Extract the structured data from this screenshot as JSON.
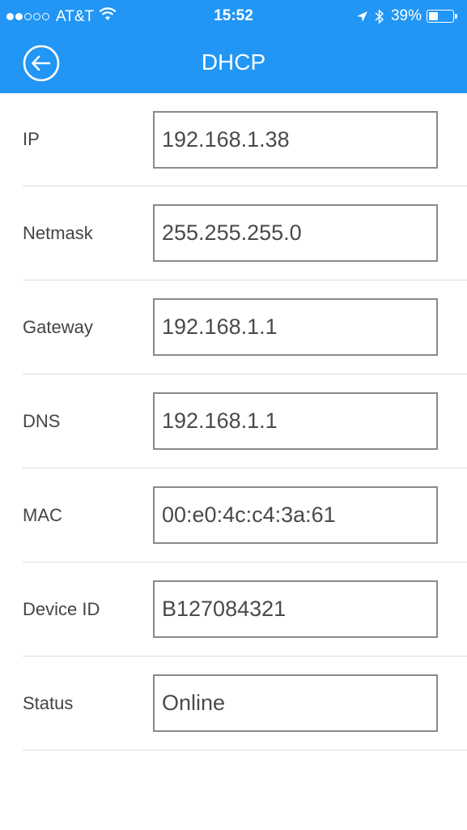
{
  "status_bar": {
    "carrier": "AT&T",
    "signal_bars_filled": 2,
    "signal_bars_total": 5,
    "time": "15:52",
    "battery_percent": "39%",
    "battery_level": 0.39,
    "icons": [
      "signal-icon",
      "wifi-icon",
      "location-arrow-icon",
      "bluetooth-icon",
      "battery-icon"
    ]
  },
  "nav": {
    "title": "DHCP",
    "back_icon": "back-arrow-circle-icon"
  },
  "colors": {
    "header_bg": "#2196f5",
    "header_text": "#ffffff",
    "label_text": "#444444",
    "field_border": "#8a8a8a",
    "divider": "#dcdcdc"
  },
  "fields": [
    {
      "label": "IP",
      "value": "192.168.1.38"
    },
    {
      "label": "Netmask",
      "value": "255.255.255.0"
    },
    {
      "label": "Gateway",
      "value": "192.168.1.1"
    },
    {
      "label": "DNS",
      "value": "192.168.1.1"
    },
    {
      "label": "MAC",
      "value": "00:e0:4c:c4:3a:61"
    },
    {
      "label": "Device ID",
      "value": "B127084321"
    },
    {
      "label": "Status",
      "value": "Online"
    }
  ]
}
